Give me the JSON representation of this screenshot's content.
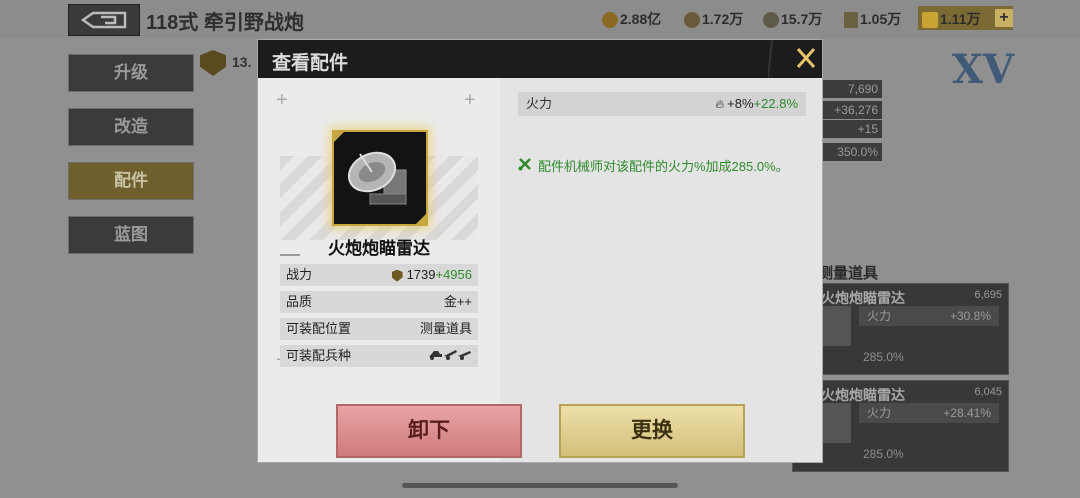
{
  "header": {
    "title": "118式 牵引野战炮",
    "resources": [
      "2.88亿",
      "1.72万",
      "15.7万",
      "1.05万",
      "1.11万"
    ],
    "plus_label": "+"
  },
  "side_menu": [
    "升级",
    "改造",
    "配件",
    "蓝图"
  ],
  "background": {
    "battle_power_partial": "13.",
    "rank_badge": "XV",
    "stat_values": [
      "7,690",
      "+36,276",
      "+15",
      "350.0%"
    ],
    "slot_title": "测量道具",
    "cards": [
      {
        "name": "火炮炮瞄雷达",
        "power": "6,695",
        "stat_label": "火力",
        "stat_value": "+30.8%",
        "bonus": "285.0%"
      },
      {
        "name": "火炮炮瞄雷达",
        "power": "6,045",
        "stat_label": "火力",
        "stat_value": "+28.41%",
        "bonus": "285.0%"
      }
    ]
  },
  "modal": {
    "title": "查看配件",
    "close_icon": "close-x",
    "item": {
      "name": "火炮炮瞄雷达",
      "rows": [
        {
          "label": "战力",
          "value": "1739",
          "bonus": "+4956"
        },
        {
          "label": "品质",
          "value": "金++"
        },
        {
          "label": "可装配位置",
          "value": "测量道具"
        },
        {
          "label": "可装配兵种",
          "value": ""
        }
      ]
    },
    "stat": {
      "label": "火力",
      "value": "+8%",
      "bonus": "+22.8%"
    },
    "mechanic_bonus": "配件机械师对该配件的火力%加成285.0%。",
    "buttons": {
      "unequip": "卸下",
      "replace": "更换"
    }
  },
  "colors": {
    "accent_gold": "#c6a640",
    "green": "#2f8a2c",
    "unequip": "#cf7b7b",
    "replace": "#d3c07a"
  }
}
